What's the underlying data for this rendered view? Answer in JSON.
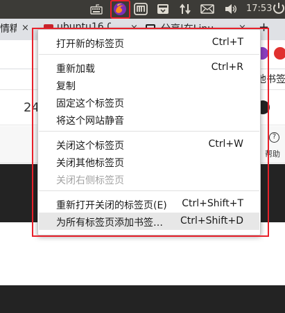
{
  "panel": {
    "clock": "17:53",
    "icons": [
      "keyboard-icon",
      "firefox-icon",
      "tray-m-icon",
      "tray-window-icon",
      "network-icon",
      "mail-icon",
      "volume-icon",
      "power-icon"
    ]
  },
  "browser": {
    "tabs": [
      {
        "title": "情精",
        "close": "×"
      },
      {
        "title": "ubuntu16.0",
        "close": "×"
      },
      {
        "title": "分享|在Linu",
        "close": "×"
      }
    ],
    "new_tab": "+",
    "bookmark_fragment": "他书签",
    "content_number": "24",
    "help_label": "帮助"
  },
  "menu": {
    "groups": [
      [
        {
          "label": "打开新的标签页",
          "shortcut": "Ctrl+T"
        }
      ],
      [
        {
          "label": "重新加载",
          "shortcut": "Ctrl+R"
        },
        {
          "label": "复制",
          "shortcut": ""
        },
        {
          "label": "固定这个标签页",
          "shortcut": ""
        },
        {
          "label": "将这个网站静音",
          "shortcut": ""
        }
      ],
      [
        {
          "label": "关闭这个标签页",
          "shortcut": "Ctrl+W"
        },
        {
          "label": "关闭其他标签页",
          "shortcut": ""
        },
        {
          "label": "关闭右侧标签页",
          "shortcut": "",
          "disabled": true
        }
      ],
      [
        {
          "label": "重新打开关闭的标签页(E)",
          "shortcut": "Ctrl+Shift+T"
        },
        {
          "label": "为所有标签页添加书签…",
          "shortcut": "Ctrl+Shift+D",
          "highlighted": true
        }
      ]
    ]
  },
  "colors": {
    "annotation": "#e8202a",
    "panel_bg": "#3c3b37",
    "dark_band": "#232323",
    "menu_highlight": "#e7e7e7",
    "disabled_text": "#a3a3a3"
  }
}
